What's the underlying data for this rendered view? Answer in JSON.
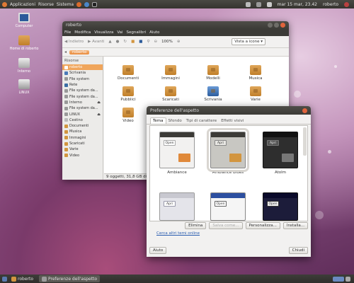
{
  "top_panel": {
    "menu": [
      "Applicazioni",
      "Risorse",
      "Sistema"
    ],
    "clock": "mar 15 mar, 23.42",
    "user": "roberto"
  },
  "desktop_icons": [
    "Computer",
    "Home di roberto",
    "Interno",
    "LINUX"
  ],
  "nautilus": {
    "title": "roberto",
    "menu": [
      "File",
      "Modifica",
      "Visualizza",
      "Vai",
      "Segnalibri",
      "Aiuto"
    ],
    "back": "Indietro",
    "forward": "Avanti",
    "zoom": "100%",
    "view_mode": "Vista a icone",
    "breadcrumb": "roberto",
    "sidebar_header": "Risorse",
    "sidebar": [
      "roberto",
      "Scrivania",
      "File system",
      "Rete",
      "File system da...",
      "File system da...",
      "Interno",
      "File system da...",
      "LINUX",
      "Cestino",
      "Documenti",
      "Musica",
      "Immagini",
      "Scaricati",
      "Varie",
      "Video"
    ],
    "files": [
      "Documenti",
      "Immagini",
      "Modelli",
      "Musica",
      "Pubblici",
      "Scaricati",
      "Scrivania",
      "Varie",
      "Video"
    ],
    "status": "9 oggetti, 31,8 GB di s"
  },
  "dialog": {
    "title": "Preferenze dell'aspetto",
    "tabs": [
      "Tema",
      "Sfondo",
      "Tipi di carattere",
      "Effetti visivi"
    ],
    "themes": [
      "Ambiance",
      "Ambiance Blues",
      "Atolm",
      "",
      "",
      ""
    ],
    "thumb_labels": [
      "Open",
      "Apri",
      "Apri",
      "Apri",
      "Open",
      "Open"
    ],
    "buttons": [
      "Elimina",
      "Salva come...",
      "Personalizza...",
      "Installa..."
    ],
    "link": "Cerca altri temi online",
    "help": "Aiuto",
    "close": "Chiudi"
  },
  "bottom_panel": {
    "tasks": [
      "roberto",
      "Preferenze dell'aspetto"
    ]
  },
  "colors": {
    "accent": "#f0a55b",
    "folder": "#d2953f",
    "panel": "#3c3b37"
  }
}
